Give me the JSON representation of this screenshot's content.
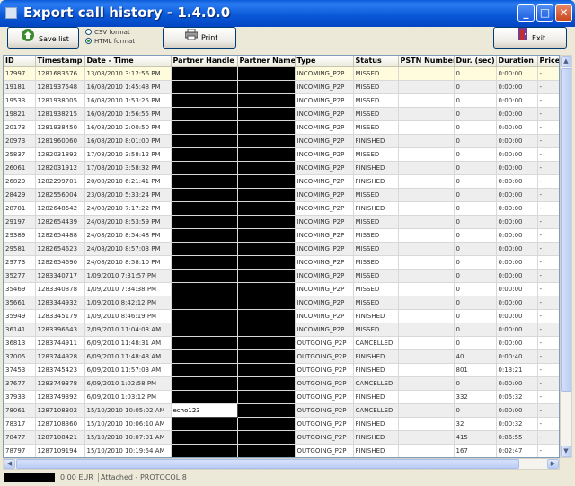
{
  "window": {
    "title": "Export call history - 1.4.0.0",
    "min": "_",
    "max": "□",
    "close": "✕"
  },
  "toolbar": {
    "save_label": "Save list",
    "csv_label": "CSV format",
    "html_label": "HTML format",
    "print_label": "Print",
    "exit_label": "Exit"
  },
  "columns": [
    "ID",
    "Timestamp",
    "Date - Time",
    "Partner Handle",
    "Partner Name",
    "Type",
    "Status",
    "PSTN Number",
    "Dur. (sec)",
    "Duration",
    "Price"
  ],
  "rows": [
    [
      "17997",
      "1281683576",
      "13/08/2010 3:12:56 PM",
      "",
      "",
      "INCOMING_P2P",
      "MISSED",
      "",
      "0",
      "0:00:00",
      "-"
    ],
    [
      "19181",
      "1281937548",
      "16/08/2010 1:45:48 PM",
      "",
      "",
      "INCOMING_P2P",
      "MISSED",
      "",
      "0",
      "0:00:00",
      "-"
    ],
    [
      "19533",
      "1281938005",
      "16/08/2010 1:53:25 PM",
      "",
      "",
      "INCOMING_P2P",
      "MISSED",
      "",
      "0",
      "0:00:00",
      "-"
    ],
    [
      "19821",
      "1281938215",
      "16/08/2010 1:56:55 PM",
      "",
      "",
      "INCOMING_P2P",
      "MISSED",
      "",
      "0",
      "0:00:00",
      "-"
    ],
    [
      "20173",
      "1281938450",
      "16/08/2010 2:00:50 PM",
      "",
      "",
      "INCOMING_P2P",
      "MISSED",
      "",
      "0",
      "0:00:00",
      "-"
    ],
    [
      "20973",
      "1281960060",
      "16/08/2010 8:01:00 PM",
      "",
      "",
      "INCOMING_P2P",
      "FINISHED",
      "",
      "0",
      "0:00:00",
      "-"
    ],
    [
      "25837",
      "1282031892",
      "17/08/2010 3:58:12 PM",
      "",
      "",
      "INCOMING_P2P",
      "MISSED",
      "",
      "0",
      "0:00:00",
      "-"
    ],
    [
      "26061",
      "1282031912",
      "17/08/2010 3:58:32 PM",
      "",
      "",
      "INCOMING_P2P",
      "FINISHED",
      "",
      "0",
      "0:00:00",
      "-"
    ],
    [
      "26829",
      "1282299701",
      "20/08/2010 6:21:41 PM",
      "",
      "",
      "INCOMING_P2P",
      "FINISHED",
      "",
      "0",
      "0:00:00",
      "-"
    ],
    [
      "28429",
      "1282556004",
      "23/08/2010 5:33:24 PM",
      "",
      "",
      "INCOMING_P2P",
      "MISSED",
      "",
      "0",
      "0:00:00",
      "-"
    ],
    [
      "28781",
      "1282648642",
      "24/08/2010 7:17:22 PM",
      "",
      "",
      "INCOMING_P2P",
      "FINISHED",
      "",
      "0",
      "0:00:00",
      "-"
    ],
    [
      "29197",
      "1282654439",
      "24/08/2010 8:53:59 PM",
      "",
      "",
      "INCOMING_P2P",
      "MISSED",
      "",
      "0",
      "0:00:00",
      "-"
    ],
    [
      "29389",
      "1282654488",
      "24/08/2010 8:54:48 PM",
      "",
      "",
      "INCOMING_P2P",
      "MISSED",
      "",
      "0",
      "0:00:00",
      "-"
    ],
    [
      "29581",
      "1282654623",
      "24/08/2010 8:57:03 PM",
      "",
      "",
      "INCOMING_P2P",
      "MISSED",
      "",
      "0",
      "0:00:00",
      "-"
    ],
    [
      "29773",
      "1282654690",
      "24/08/2010 8:58:10 PM",
      "",
      "",
      "INCOMING_P2P",
      "MISSED",
      "",
      "0",
      "0:00:00",
      "-"
    ],
    [
      "35277",
      "1283340717",
      "1/09/2010 7:31:57 PM",
      "",
      "",
      "INCOMING_P2P",
      "MISSED",
      "",
      "0",
      "0:00:00",
      "-"
    ],
    [
      "35469",
      "1283340878",
      "1/09/2010 7:34:38 PM",
      "",
      "",
      "INCOMING_P2P",
      "MISSED",
      "",
      "0",
      "0:00:00",
      "-"
    ],
    [
      "35661",
      "1283344932",
      "1/09/2010 8:42:12 PM",
      "",
      "",
      "INCOMING_P2P",
      "MISSED",
      "",
      "0",
      "0:00:00",
      "-"
    ],
    [
      "35949",
      "1283345179",
      "1/09/2010 8:46:19 PM",
      "",
      "",
      "INCOMING_P2P",
      "FINISHED",
      "",
      "0",
      "0:00:00",
      "-"
    ],
    [
      "36141",
      "1283396643",
      "2/09/2010 11:04:03 AM",
      "",
      "",
      "INCOMING_P2P",
      "MISSED",
      "",
      "0",
      "0:00:00",
      "-"
    ],
    [
      "36813",
      "1283744911",
      "6/09/2010 11:48:31 AM",
      "",
      "",
      "OUTGOING_P2P",
      "CANCELLED",
      "",
      "0",
      "0:00:00",
      "-"
    ],
    [
      "37005",
      "1283744928",
      "6/09/2010 11:48:48 AM",
      "",
      "",
      "OUTGOING_P2P",
      "FINISHED",
      "",
      "40",
      "0:00:40",
      "-"
    ],
    [
      "37453",
      "1283745423",
      "6/09/2010 11:57:03 AM",
      "",
      "",
      "OUTGOING_P2P",
      "FINISHED",
      "",
      "801",
      "0:13:21",
      "-"
    ],
    [
      "37677",
      "1283749378",
      "6/09/2010 1:02:58 PM",
      "",
      "",
      "OUTGOING_P2P",
      "CANCELLED",
      "",
      "0",
      "0:00:00",
      "-"
    ],
    [
      "37933",
      "1283749392",
      "6/09/2010 1:03:12 PM",
      "",
      "",
      "OUTGOING_P2P",
      "FINISHED",
      "",
      "332",
      "0:05:32",
      "-"
    ],
    [
      "78061",
      "1287108302",
      "15/10/2010 10:05:02 AM",
      "echo123",
      "",
      "OUTGOING_P2P",
      "CANCELLED",
      "",
      "0",
      "0:00:00",
      "-"
    ],
    [
      "78317",
      "1287108360",
      "15/10/2010 10:06:10 AM",
      "",
      "",
      "OUTGOING_P2P",
      "FINISHED",
      "",
      "32",
      "0:00:32",
      "-"
    ],
    [
      "78477",
      "1287108421",
      "15/10/2010 10:07:01 AM",
      "",
      "",
      "OUTGOING_P2P",
      "FINISHED",
      "",
      "415",
      "0:06:55",
      "-"
    ],
    [
      "78797",
      "1287109194",
      "15/10/2010 10:19:54 AM",
      "",
      "",
      "OUTGOING_P2P",
      "FINISHED",
      "",
      "167",
      "0:02:47",
      "-"
    ]
  ],
  "status": {
    "balance": "0.00 EUR",
    "connection": "Attached - PROTOCOL 8"
  }
}
